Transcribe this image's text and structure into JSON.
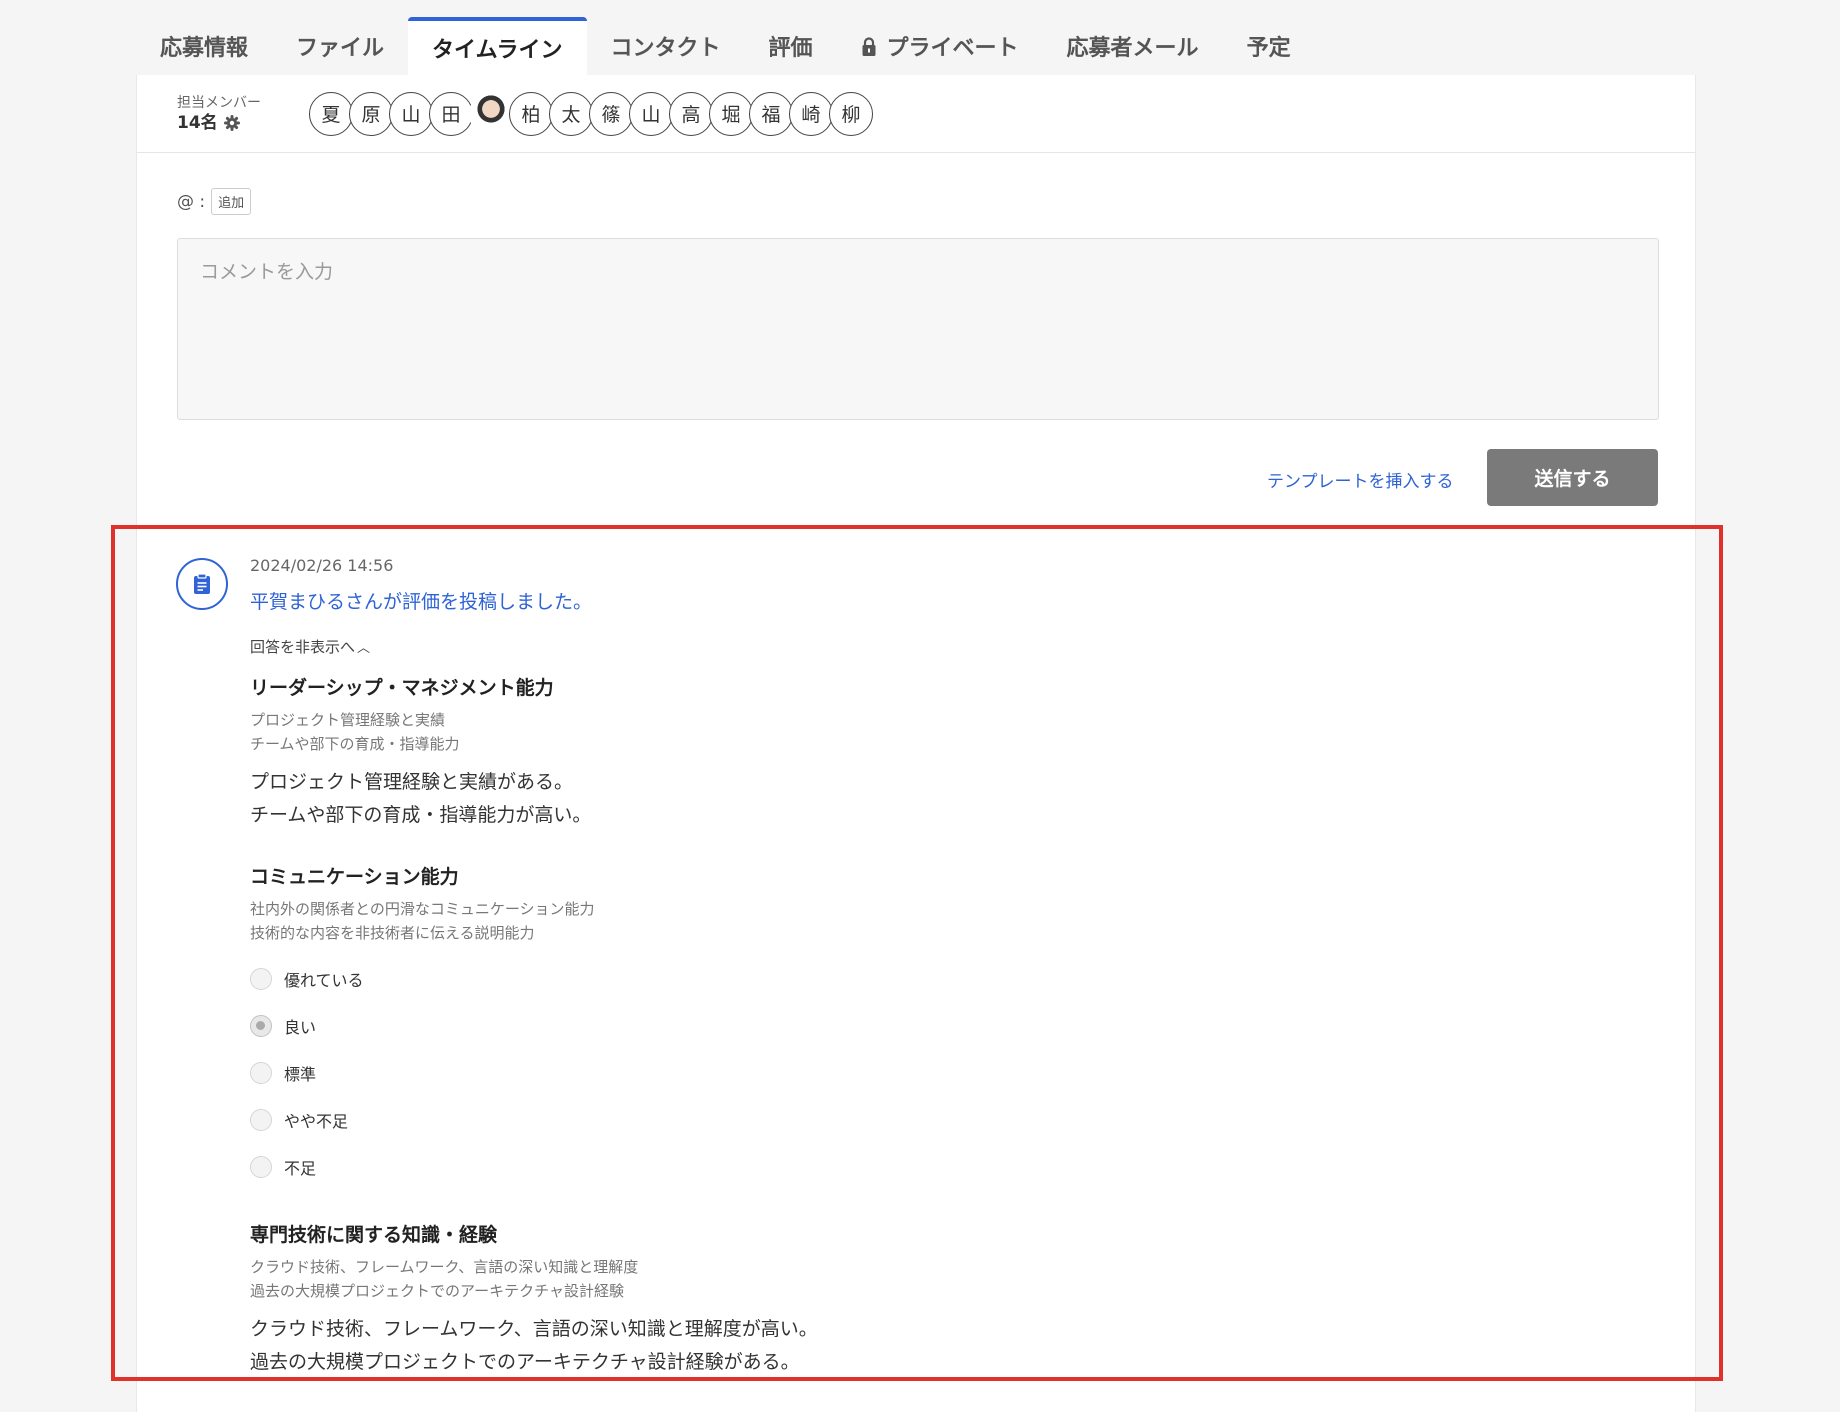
{
  "tabs": [
    {
      "label": "応募情報"
    },
    {
      "label": "ファイル"
    },
    {
      "label": "タイムライン"
    },
    {
      "label": "コンタクト"
    },
    {
      "label": "評価"
    },
    {
      "label": "プライベート"
    },
    {
      "label": "応募者メール"
    },
    {
      "label": "予定"
    }
  ],
  "active_tab": "タイムライン",
  "members": {
    "label": "担当メンバー",
    "count": "14名",
    "avatars": [
      "夏",
      "原",
      "山",
      "田",
      "",
      "柏",
      "太",
      "篠",
      "山",
      "高",
      "堀",
      "福",
      "崎",
      "柳"
    ]
  },
  "mention": {
    "prefix": "@ :",
    "add_label": "追加"
  },
  "comment": {
    "placeholder": "コメントを入力",
    "template_link": "テンプレートを挿入する",
    "send_label": "送信する"
  },
  "entry": {
    "timestamp": "2024/02/26 14:56",
    "title": "平賀まひるさんが評価を投稿しました。",
    "toggle": "回答を非表示へ",
    "sections": [
      {
        "title": "リーダーシップ・マネジメント能力",
        "sub1": "プロジェクト管理経験と実績",
        "sub2": "チームや部下の育成・指導能力",
        "answer1": "プロジェクト管理経験と実績がある。",
        "answer2": "チームや部下の育成・指導能力が高い。"
      },
      {
        "title": "コミュニケーション能力",
        "sub1": "社内外の関係者との円滑なコミュニケーション能力",
        "sub2": "技術的な内容を非技術者に伝える説明能力",
        "options": [
          "優れている",
          "良い",
          "標準",
          "やや不足",
          "不足"
        ],
        "selected": "良い"
      },
      {
        "title": "専門技術に関する知識・経験",
        "sub1": "クラウド技術、フレームワーク、言語の深い知識と理解度",
        "sub2": "過去の大規模プロジェクトでのアーキテクチャ設計経験",
        "answer1": "クラウド技術、フレームワーク、言語の深い知識と理解度が高い。",
        "answer2": "過去の大規模プロジェクトでのアーキテクチャ設計経験がある。"
      }
    ]
  },
  "colors": {
    "accent": "#2f63d6",
    "highlight": "#e0322a",
    "send_button": "#7a7a7a"
  }
}
